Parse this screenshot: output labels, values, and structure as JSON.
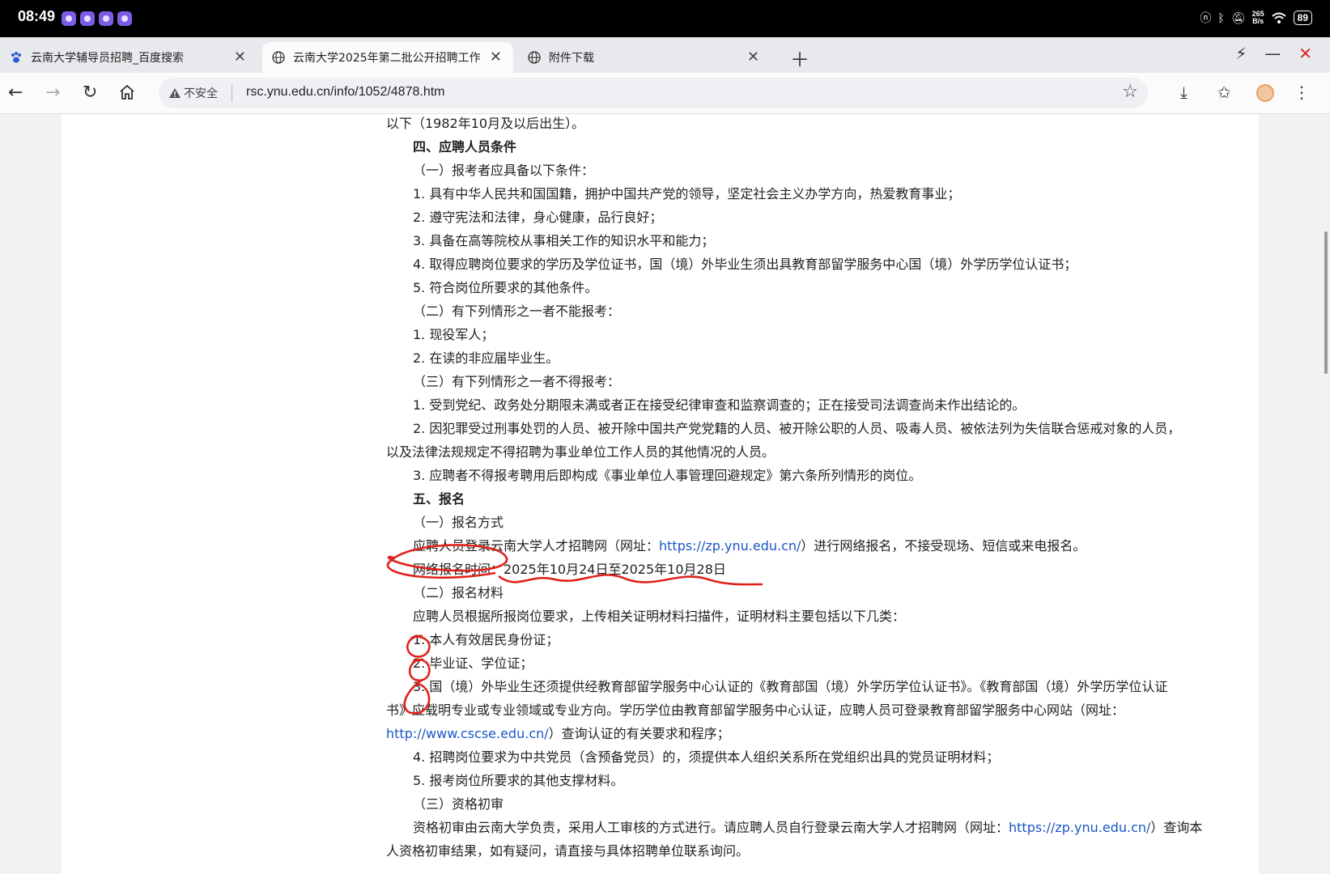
{
  "status": {
    "time": "08:49",
    "net_speed_value": "265",
    "net_speed_unit": "B/s",
    "battery": "89"
  },
  "tabs": [
    {
      "title": "云南大学辅导员招聘_百度搜索",
      "icon": "baidu-icon",
      "active": false
    },
    {
      "title": "云南大学2025年第二批公开招聘工作",
      "icon": "globe-icon",
      "active": true
    },
    {
      "title": "附件下载",
      "icon": "globe-icon",
      "active": false
    }
  ],
  "toolbar": {
    "insecure_label": "不安全",
    "url": "rsc.ynu.edu.cn/info/1052/4878.htm"
  },
  "content": {
    "lines": [
      {
        "text": "以下（1982年10月及以后出生）。"
      },
      {
        "text": "四、应聘人员条件"
      },
      {
        "text": "（一）报考者应具备以下条件："
      },
      {
        "text": "1. 具有中华人民共和国国籍，拥护中国共产党的领导，坚定社会主义办学方向，热爱教育事业；"
      },
      {
        "text": "2. 遵守宪法和法律，身心健康，品行良好；"
      },
      {
        "text": "3. 具备在高等院校从事相关工作的知识水平和能力；"
      },
      {
        "text": "4. 取得应聘岗位要求的学历及学位证书，国（境）外毕业生须出具教育部留学服务中心国（境）外学历学位认证书；"
      },
      {
        "text": "5. 符合岗位所要求的其他条件。"
      },
      {
        "text": "（二）有下列情形之一者不能报考："
      },
      {
        "text": "1. 现役军人；"
      },
      {
        "text": "2. 在读的非应届毕业生。"
      },
      {
        "text": "（三）有下列情形之一者不得报考："
      },
      {
        "text": "1. 受到党纪、政务处分期限未满或者正在接受纪律审查和监察调查的；正在接受司法调查尚未作出结论的。"
      },
      {
        "text": "2. 因犯罪受过刑事处罚的人员、被开除中国共产党党籍的人员、被开除公职的人员、吸毒人员、被依法列为失信联合惩戒对象的人员，"
      },
      {
        "text": "以及法律法规规定不得招聘为事业单位工作人员的其他情况的人员。"
      },
      {
        "text": "3. 应聘者不得报考聘用后即构成《事业单位人事管理回避规定》第六条所列情形的岗位。"
      },
      {
        "text": "五、报名"
      },
      {
        "text": "（一）报名方式"
      },
      {
        "text_a": "应聘人员登录云南大学人才招聘网（网址：",
        "link": "https://zp.ynu.edu.cn/",
        "text_b": "）进行网络报名，不接受现场、短信或来电报名。"
      },
      {
        "text": "网络报名时间：2025年10月24日至2025年10月28日"
      },
      {
        "text": "（二）报名材料"
      },
      {
        "text": "应聘人员根据所报岗位要求，上传相关证明材料扫描件，证明材料主要包括以下几类："
      },
      {
        "text": "1. 本人有效居民身份证；"
      },
      {
        "text": "2. 毕业证、学位证；"
      },
      {
        "text": "3. 国（境）外毕业生还须提供经教育部留学服务中心认证的《教育部国（境）外学历学位认证书》。《教育部国（境）外学历学位认证"
      },
      {
        "text": "书》应载明专业或专业领域或专业方向。学历学位由教育部留学服务中心认证，应聘人员可登录教育部留学服务中心网站（网址："
      },
      {
        "link": "http://www.cscse.edu.cn/",
        "text_b": "）查询认证的有关要求和程序；"
      },
      {
        "text": "4. 招聘岗位要求为中共党员（含预备党员）的，须提供本人组织关系所在党组织出具的党员证明材料；"
      },
      {
        "text": "5. 报考岗位所要求的其他支撑材料。"
      },
      {
        "text": "（三）资格初审"
      },
      {
        "text_a": "资格初审由云南大学负责，采用人工审核的方式进行。请应聘人员自行登录云南大学人才招聘网（网址：",
        "link": "https://zp.ynu.edu.cn/",
        "text_b": "）查询本"
      },
      {
        "text": "人资格初审结果，如有疑问，请直接与具体招聘单位联系询问。"
      }
    ]
  },
  "colors": {
    "link": "#1a56c4",
    "annotation": "#e0221c",
    "status_bar": "#000000"
  }
}
